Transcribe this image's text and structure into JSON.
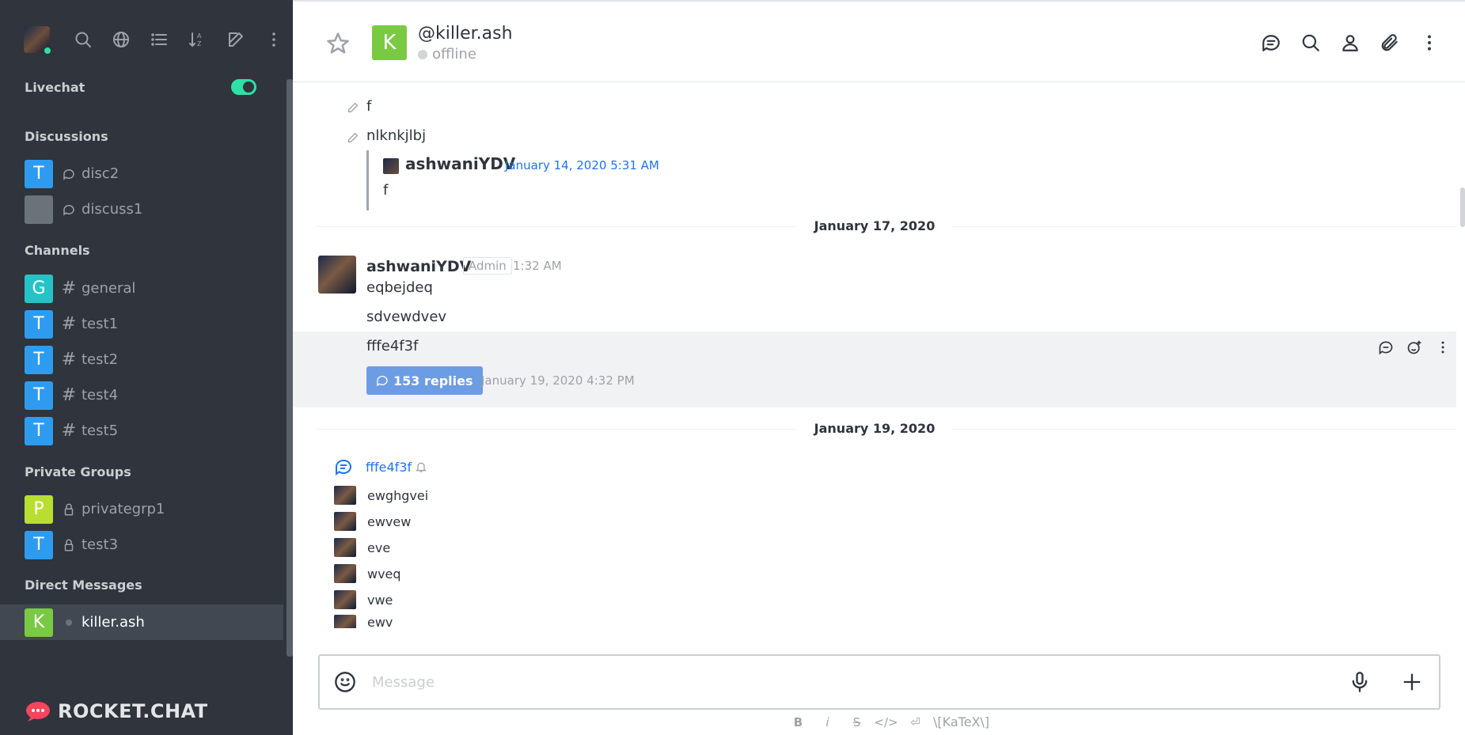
{
  "sidebar": {
    "livechat_label": "Livechat",
    "sections": {
      "discussions": "Discussions",
      "channels": "Channels",
      "private_groups": "Private Groups",
      "direct_messages": "Direct Messages"
    },
    "discussions": [
      {
        "initial": "T",
        "label": "disc2",
        "color": "#2d9cf0"
      },
      {
        "initial": "",
        "label": "discuss1",
        "color": "#6c727a"
      }
    ],
    "channels": [
      {
        "initial": "G",
        "label": "general",
        "color": "#26c3c6"
      },
      {
        "initial": "T",
        "label": "test1",
        "color": "#2d9cf0"
      },
      {
        "initial": "T",
        "label": "test2",
        "color": "#2d9cf0"
      },
      {
        "initial": "T",
        "label": "test4",
        "color": "#2d9cf0"
      },
      {
        "initial": "T",
        "label": "test5",
        "color": "#2d9cf0"
      }
    ],
    "private_groups": [
      {
        "initial": "P",
        "label": "privategrp1",
        "color": "#b9de30"
      },
      {
        "initial": "T",
        "label": "test3",
        "color": "#2d9cf0"
      }
    ],
    "direct_messages": [
      {
        "initial": "K",
        "label": "killer.ash",
        "color": "#7ac943"
      }
    ],
    "logo_text": "ROCKET.CHAT"
  },
  "header": {
    "avatar_initial": "K",
    "title": "@killer.ash",
    "status": "offline"
  },
  "messages": {
    "edited_1": "f",
    "edited_2": "nlknkjlbj",
    "quote": {
      "user": "ashwaniYDV",
      "time": "January 14, 2020 5:31 AM",
      "text": "f"
    },
    "date_divider_1": "January 17, 2020",
    "group": {
      "user": "ashwaniYDV",
      "role": "Admin",
      "time": "1:32 AM",
      "lines": [
        "eqbejdeq",
        "sdvewdvev",
        "fffe4f3f"
      ]
    },
    "thread_button": "153 replies",
    "thread_last_time": "January 19, 2020 4:32 PM",
    "date_divider_2": "January 19, 2020",
    "thread_title": "fffe4f3f",
    "replies": [
      "ewghgvei",
      "ewvew",
      "eve",
      "wveq",
      "vwe",
      "ewv"
    ]
  },
  "composer": {
    "placeholder": "Message",
    "formatting": [
      "B",
      "i",
      "S",
      "</>",
      "⏎"
    ],
    "katex": "\\[KaTeX\\]"
  }
}
